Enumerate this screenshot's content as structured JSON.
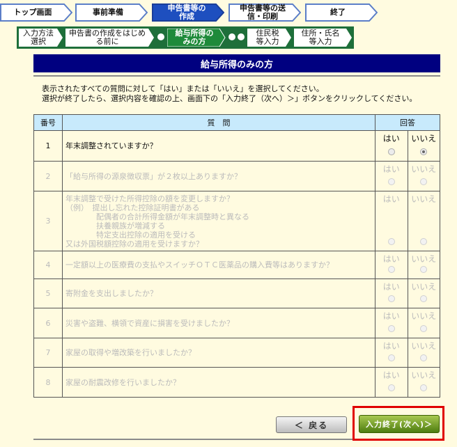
{
  "steps": [
    {
      "label": "トップ画面",
      "active": false
    },
    {
      "label": "事前準備",
      "active": false
    },
    {
      "label": "申告書等の作成",
      "active": true
    },
    {
      "label": "申告書等の送信・印刷",
      "active": false
    },
    {
      "label": "終了",
      "active": false
    }
  ],
  "substeps": [
    {
      "label": "入力方法選択",
      "active": false
    },
    {
      "label": "申告書の作成をはじめる前に",
      "active": false
    },
    {
      "label": "給与所得のみの方",
      "active": true
    },
    {
      "label": "住民税等入力",
      "active": false
    },
    {
      "label": "住所・氏名等入力",
      "active": false
    }
  ],
  "page_title": "給与所得のみの方",
  "instructions": [
    "表示されたすべての質問に対して「はい」または「いいえ」を選択してください。",
    "選択が終了したら、選択内容を確認の上、画面下の「入力終了（次へ）＞」ボタンをクリックしてください。"
  ],
  "table": {
    "headers": {
      "num": "番号",
      "question": "質　問",
      "answer": "回答"
    },
    "yes": "はい",
    "no": "いいえ",
    "rows": [
      {
        "num": "1",
        "question": "年末調整されていますか？",
        "enabled": true,
        "selected": "no"
      },
      {
        "num": "2",
        "question": "「給与所得の源泉徴収票」が２枚以上ありますか？",
        "enabled": false,
        "selected": ""
      },
      {
        "num": "3",
        "question": "年末調整で受けた所得控除の額を変更しますか？\n（例）　提出し忘れた控除証明書がある\n　　　　配偶者の合計所得金額が年末調整時と異なる\n　　　　扶養親族が増減する\n　　　　特定支出控除の適用を受ける\n又は外国税額控除の適用を受けますか？",
        "enabled": false,
        "selected": ""
      },
      {
        "num": "4",
        "question": "一定額以上の医療費の支払やスイッチＯＴＣ医薬品の購入費等はありますか？",
        "enabled": false,
        "selected": ""
      },
      {
        "num": "5",
        "question": "寄附金を支出しましたか？",
        "enabled": false,
        "selected": ""
      },
      {
        "num": "6",
        "question": "災害や盗難、横領で資産に損害を受けましたか？",
        "enabled": false,
        "selected": ""
      },
      {
        "num": "7",
        "question": "家屋の取得や増改築を行いましたか？",
        "enabled": false,
        "selected": ""
      },
      {
        "num": "8",
        "question": "家屋の耐震改修を行いましたか？",
        "enabled": false,
        "selected": ""
      }
    ]
  },
  "buttons": {
    "back": "＜ 戻る",
    "next": "入力終了(次へ)＞"
  },
  "colors": {
    "title_bg": "#000080",
    "active_step": "#1e4fbf",
    "sub_active": "#1e8a3a",
    "highlight": "#e00000"
  }
}
